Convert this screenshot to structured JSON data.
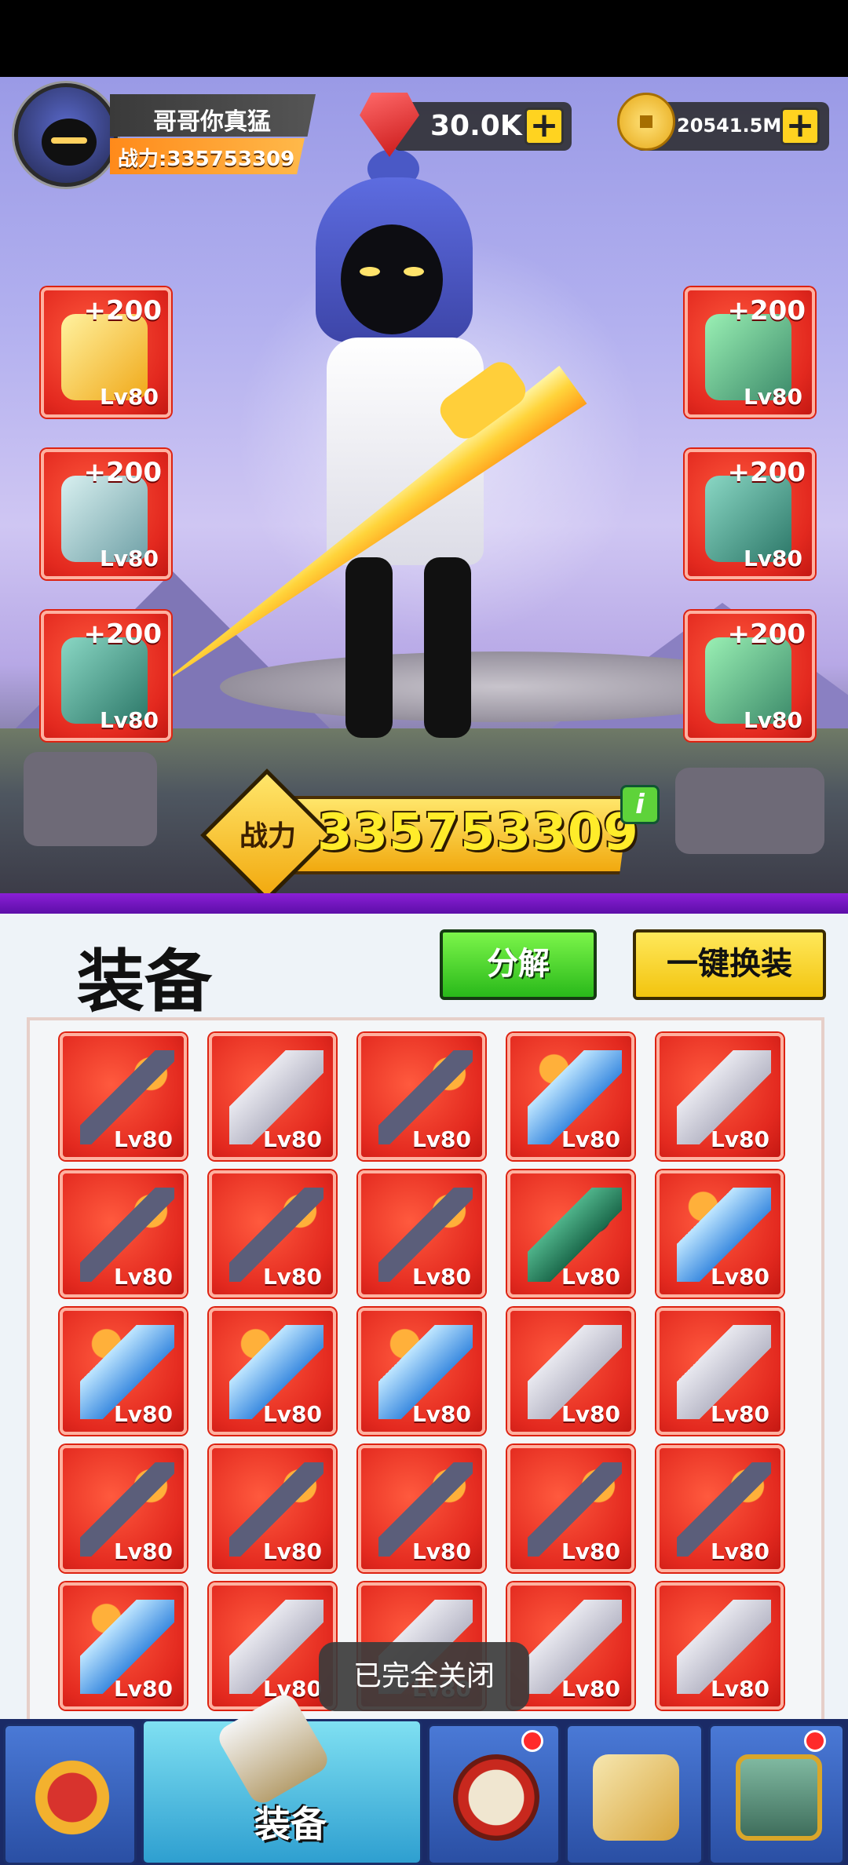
{
  "player": {
    "name": "哥哥你真猛",
    "power_label": "战力:335753309"
  },
  "resources": {
    "gems": "30.0K",
    "coins": "20541.5M",
    "plus_symbol": "+"
  },
  "equipped": {
    "left": [
      {
        "plus": "+200",
        "level": "Lv80",
        "icon": "golden-sword-icon"
      },
      {
        "plus": "+200",
        "level": "Lv80",
        "icon": "armor-plate-icon"
      },
      {
        "plus": "+200",
        "level": "Lv80",
        "icon": "ring-icon"
      }
    ],
    "right": [
      {
        "plus": "+200",
        "level": "Lv80",
        "icon": "helmet-icon"
      },
      {
        "plus": "+200",
        "level": "Lv80",
        "icon": "chest-armor-icon"
      },
      {
        "plus": "+200",
        "level": "Lv80",
        "icon": "gauntlet-icon"
      }
    ]
  },
  "power_banner": {
    "label": "战力",
    "value": "335753309",
    "info": "i"
  },
  "equipment_panel": {
    "title": "装备",
    "split_button": "分解",
    "equip_all_button": "一键换装",
    "items": [
      {
        "level": "Lv80",
        "icon": "spear-icon"
      },
      {
        "level": "Lv80",
        "icon": "cleaver-icon"
      },
      {
        "level": "Lv80",
        "icon": "spear-icon"
      },
      {
        "level": "Lv80",
        "icon": "blue-sword-icon"
      },
      {
        "level": "Lv80",
        "icon": "cleaver-icon"
      },
      {
        "level": "Lv80",
        "icon": "spear-icon"
      },
      {
        "level": "Lv80",
        "icon": "spear-icon"
      },
      {
        "level": "Lv80",
        "icon": "spear-icon"
      },
      {
        "level": "Lv80",
        "icon": "jade-sword-icon"
      },
      {
        "level": "Lv80",
        "icon": "blue-sword-icon"
      },
      {
        "level": "Lv80",
        "icon": "blue-sword-icon"
      },
      {
        "level": "Lv80",
        "icon": "blue-sword-icon"
      },
      {
        "level": "Lv80",
        "icon": "blue-sword-icon"
      },
      {
        "level": "Lv80",
        "icon": "cleaver-icon"
      },
      {
        "level": "Lv80",
        "icon": "cleaver-icon"
      },
      {
        "level": "Lv80",
        "icon": "spear-icon"
      },
      {
        "level": "Lv80",
        "icon": "spear-icon"
      },
      {
        "level": "Lv80",
        "icon": "spear-icon"
      },
      {
        "level": "Lv80",
        "icon": "spear-icon"
      },
      {
        "level": "Lv80",
        "icon": "spear-icon"
      },
      {
        "level": "Lv80",
        "icon": "blue-sword-icon"
      },
      {
        "level": "Lv80",
        "icon": "cleaver-icon"
      },
      {
        "level": "Lv80",
        "icon": "cleaver-icon"
      },
      {
        "level": "Lv80",
        "icon": "cleaver-icon"
      },
      {
        "level": "Lv80",
        "icon": "cleaver-icon"
      }
    ]
  },
  "toast": "已完全关闭",
  "navbar": {
    "tabs": [
      {
        "name": "hero",
        "icon": "masked-hero-icon",
        "badge": false
      },
      {
        "name": "equipment",
        "label": "装备",
        "icon": "sword-icon",
        "active": true
      },
      {
        "name": "drum",
        "icon": "drum-icon",
        "badge": true
      },
      {
        "name": "scroll",
        "icon": "scroll-icon",
        "badge": false
      },
      {
        "name": "shop",
        "icon": "treasure-gate-icon",
        "badge": true
      }
    ]
  }
}
